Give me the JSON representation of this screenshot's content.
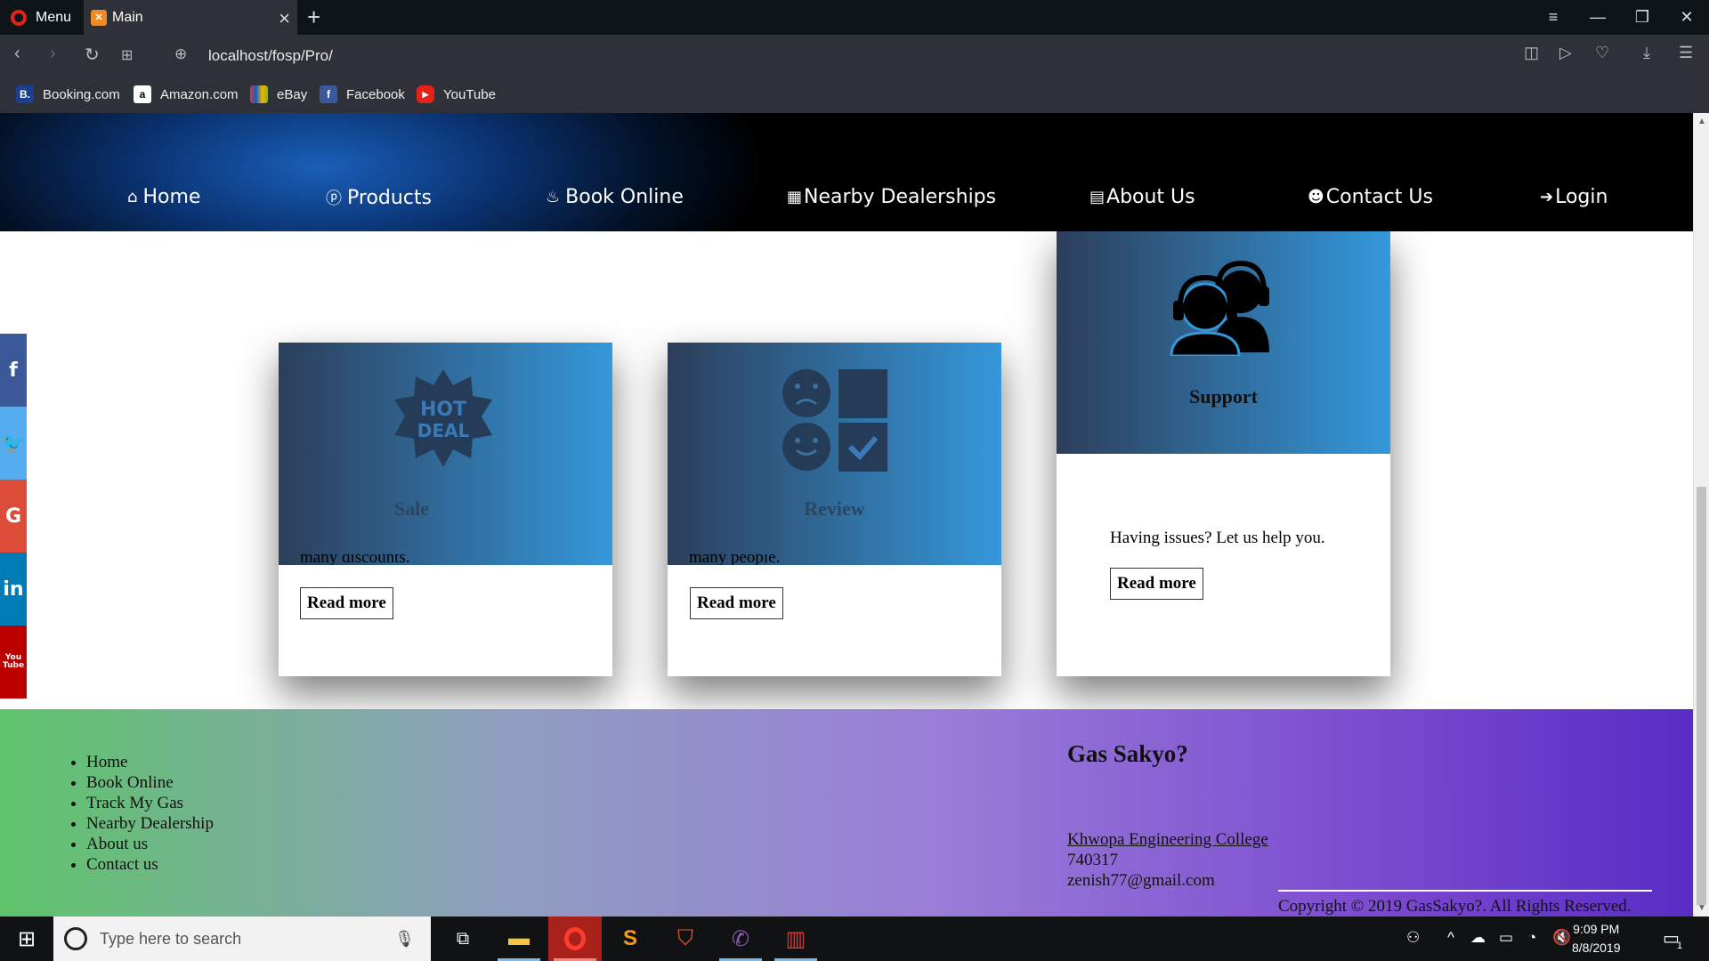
{
  "browser": {
    "menu_label": "Menu",
    "tab_title": "Main",
    "url": "localhost/fosp/Pro/",
    "bookmarks": [
      {
        "label": "Booking.com",
        "icon": "booking-icon"
      },
      {
        "label": "Amazon.com",
        "icon": "amazon-icon"
      },
      {
        "label": "eBay",
        "icon": "ebay-icon"
      },
      {
        "label": "Facebook",
        "icon": "facebook-icon"
      },
      {
        "label": "YouTube",
        "icon": "youtube-icon"
      }
    ]
  },
  "nav": {
    "items": [
      {
        "label": "Home",
        "icon": "home-icon"
      },
      {
        "label": "Products",
        "icon": "products-icon"
      },
      {
        "label": "Book Online",
        "icon": "fire-icon"
      },
      {
        "label": "Nearby Dealerships",
        "icon": "building-icon"
      },
      {
        "label": "About Us",
        "icon": "id-card-icon"
      },
      {
        "label": "Contact Us",
        "icon": "user-icon"
      },
      {
        "label": "Login",
        "icon": "sign-in-icon"
      }
    ]
  },
  "social": [
    {
      "name": "facebook",
      "glyph": "f",
      "color": "#3b5998"
    },
    {
      "name": "twitter",
      "glyph": "t",
      "color": "#55acee"
    },
    {
      "name": "google",
      "glyph": "G",
      "color": "#dd4b39"
    },
    {
      "name": "linkedin",
      "glyph": "in",
      "color": "#007bb5"
    },
    {
      "name": "youtube",
      "glyph": "You Tube",
      "color": "#bb0000"
    }
  ],
  "cards": [
    {
      "title": "Sale",
      "text_fragment": "many discounts.",
      "button": "Read more",
      "icon": "hot-deal-icon"
    },
    {
      "title": "Review",
      "text_fragment": "many people.",
      "button": "Read more",
      "icon": "review-icon"
    },
    {
      "title": "Support",
      "text": "Having issues? Let us help you.",
      "button": "Read more",
      "icon": "support-headset-icon"
    }
  ],
  "footer": {
    "links": [
      "Home",
      "Book Online",
      "Track My Gas",
      "Nearby Dealership",
      "About us",
      "Contact us"
    ],
    "brand": "Gas Sakyo?",
    "college": "Khwopa Engineering College",
    "postal": "740317",
    "email": "zenish77@gmail.com",
    "copyright": "Copyright © 2019 GasSakyo?. All Rights Reserved."
  },
  "taskbar": {
    "search_placeholder": "Type here to search",
    "time": "9:09 PM",
    "date": "8/8/2019",
    "notification_count": "1"
  }
}
